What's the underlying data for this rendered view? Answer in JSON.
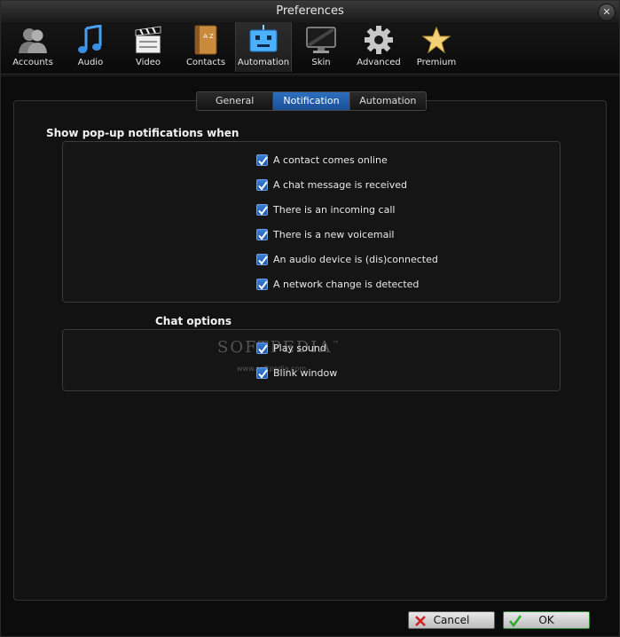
{
  "window": {
    "title": "Preferences",
    "close_glyph": "✕"
  },
  "toolbar": {
    "items": [
      {
        "label": "Accounts",
        "icon": "accounts-icon"
      },
      {
        "label": "Audio",
        "icon": "audio-icon"
      },
      {
        "label": "Video",
        "icon": "video-icon"
      },
      {
        "label": "Contacts",
        "icon": "contacts-icon"
      },
      {
        "label": "Automation",
        "icon": "automation-icon",
        "active": true
      },
      {
        "label": "Skin",
        "icon": "skin-icon"
      },
      {
        "label": "Advanced",
        "icon": "gear-icon"
      },
      {
        "label": "Premium",
        "icon": "star-icon"
      }
    ],
    "contacts_icon_letters": "A Z"
  },
  "tabs": [
    {
      "label": "General"
    },
    {
      "label": "Notification",
      "active": true
    },
    {
      "label": "Automation"
    }
  ],
  "popup": {
    "title": "Show pop-up notifications when",
    "options": [
      {
        "label": "A contact comes online",
        "checked": true
      },
      {
        "label": "A chat message is received",
        "checked": true
      },
      {
        "label": "There is an incoming call",
        "checked": true
      },
      {
        "label": "There is a new voicemail",
        "checked": true
      },
      {
        "label": "An audio device is (dis)connected",
        "checked": true
      },
      {
        "label": "A network change is detected",
        "checked": true
      }
    ]
  },
  "chat": {
    "title": "Chat options",
    "options": [
      {
        "label": "Play sound",
        "checked": true
      },
      {
        "label": "Blink window",
        "checked": true
      }
    ]
  },
  "watermark": {
    "text": "SOFTPEDIA",
    "tm": "™",
    "sub": "www.softpedia.com"
  },
  "buttons": {
    "cancel": "Cancel",
    "ok": "OK"
  },
  "colors": {
    "accent": "#2c6fbf",
    "ok_icon": "#2faa2f",
    "cancel_icon": "#d02020"
  }
}
